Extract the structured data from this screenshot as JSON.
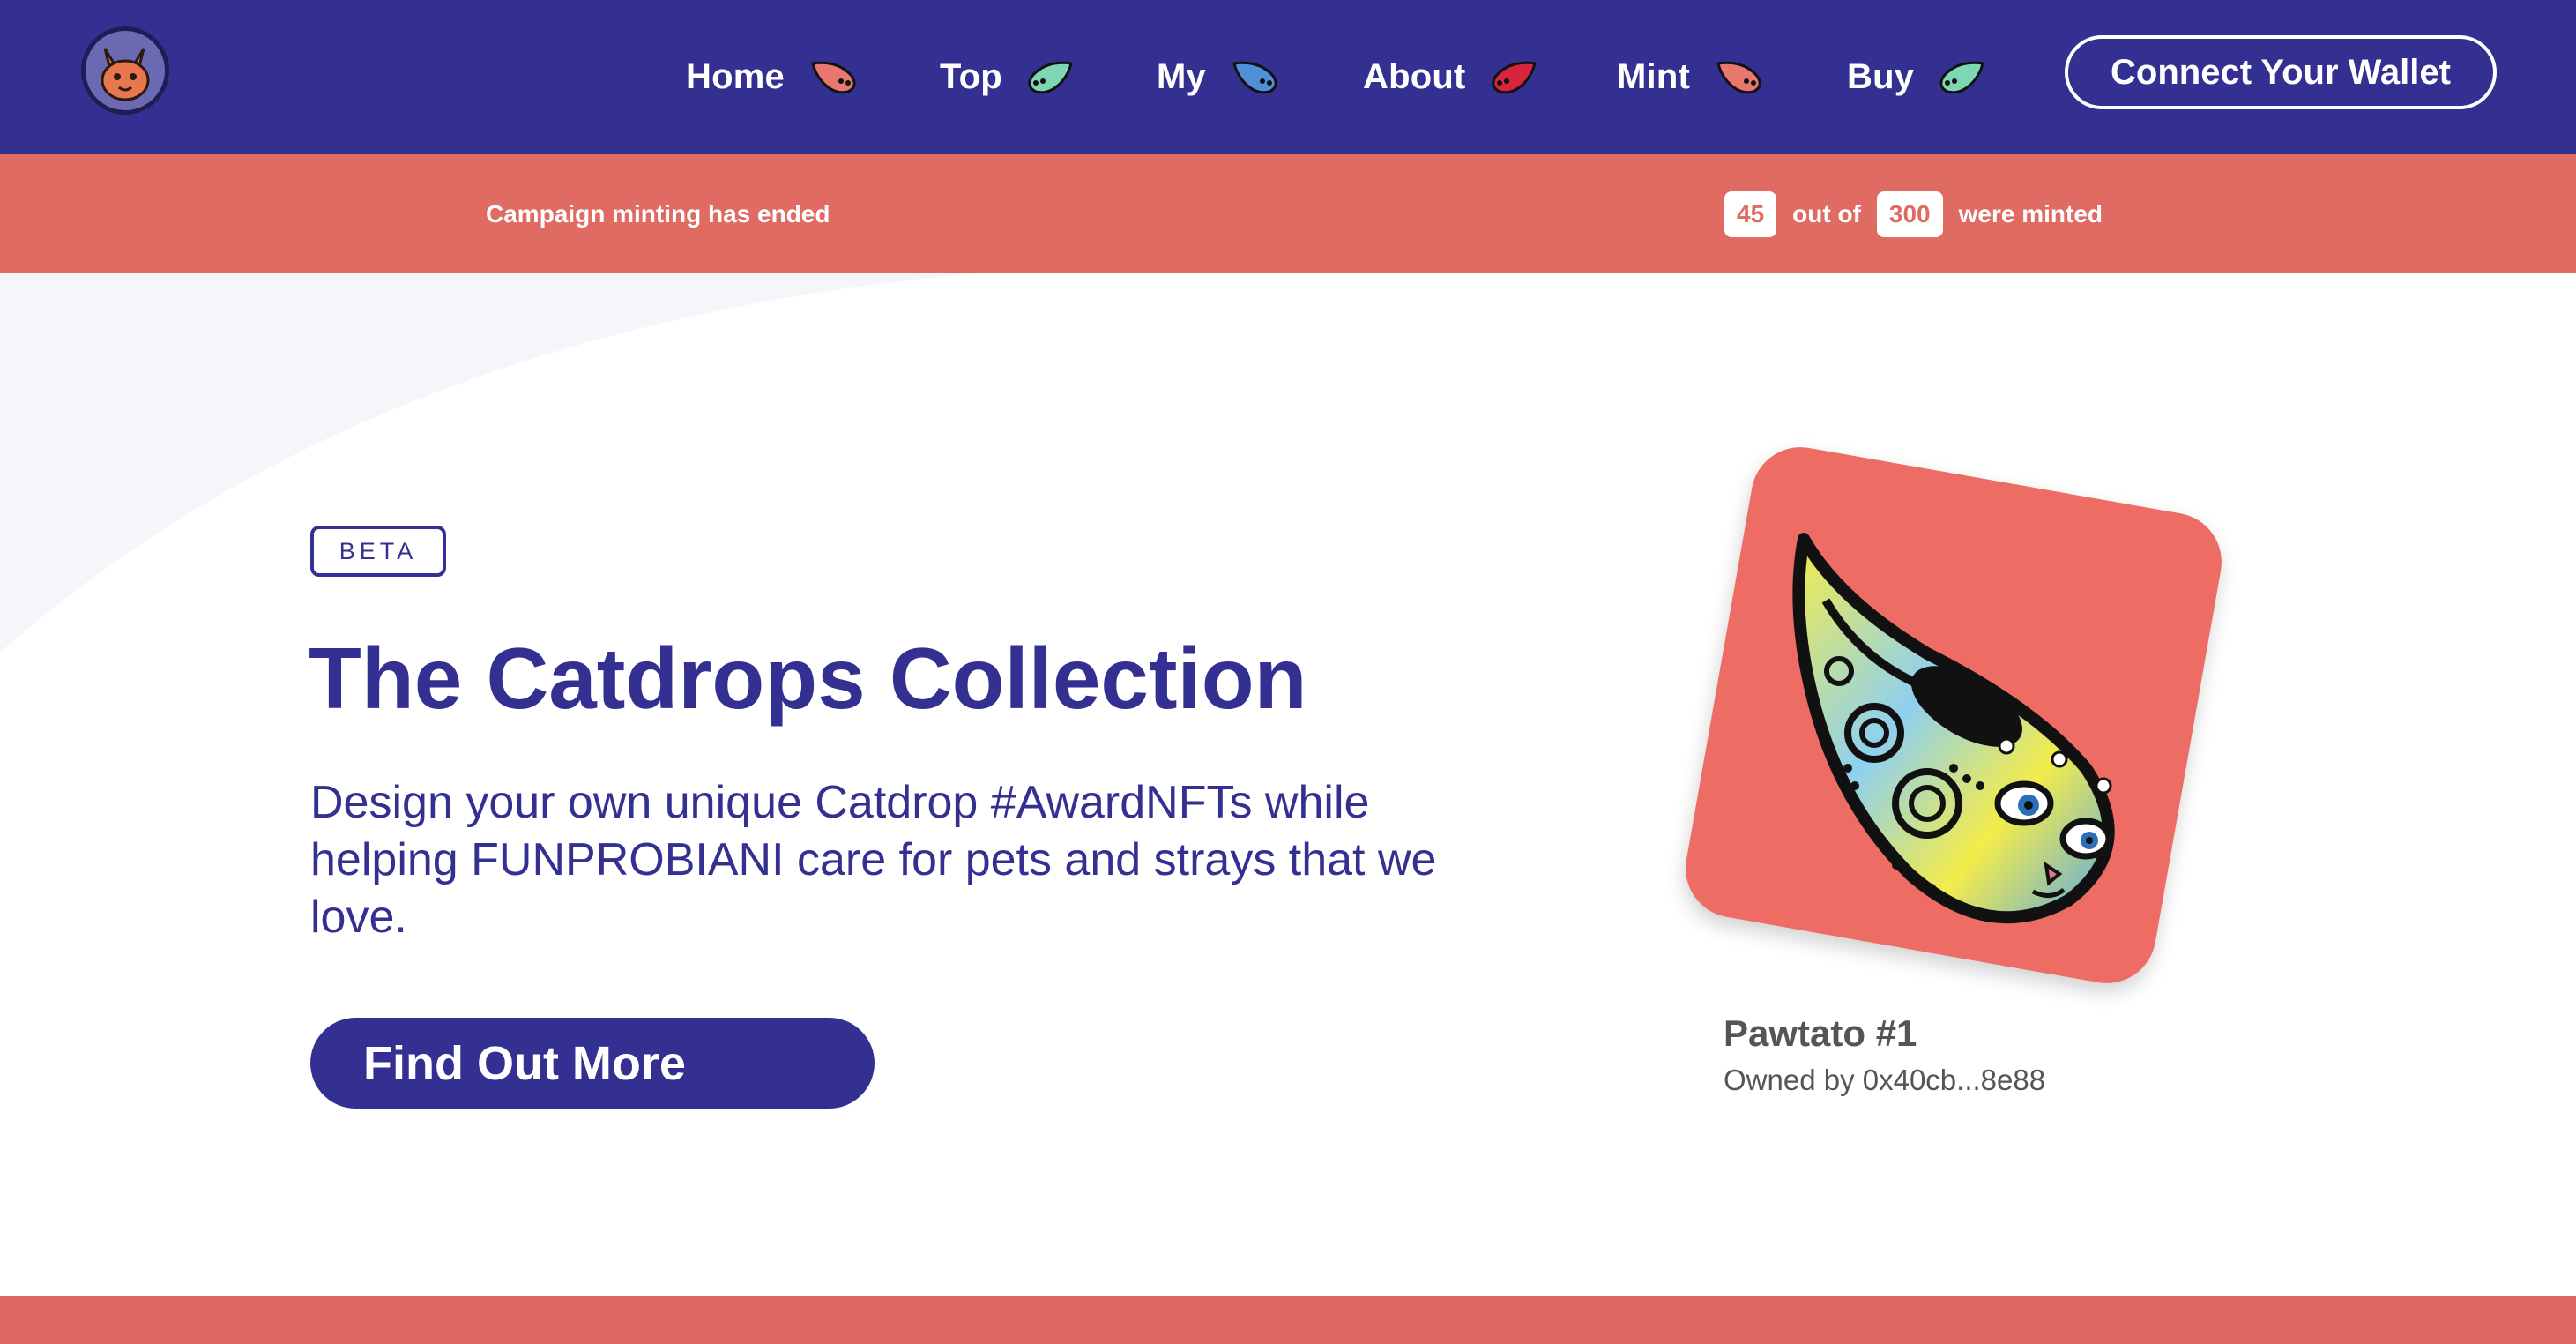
{
  "header": {
    "logo_alt": "Catdrops logo",
    "nav": [
      {
        "label": "Home",
        "drop_color": "#e8776f"
      },
      {
        "label": "Top",
        "drop_color": "#7ed7b4"
      },
      {
        "label": "My",
        "drop_color": "#4f8fd8"
      },
      {
        "label": "About",
        "drop_color": "#d8243f"
      },
      {
        "label": "Mint",
        "drop_color": "#e8776f"
      },
      {
        "label": "Buy",
        "drop_color": "#7ed7b4"
      }
    ],
    "connect_label": "Connect Your Wallet"
  },
  "status": {
    "campaign_text": "Campaign minting has ended",
    "minted": "45",
    "out_of_label": "out of",
    "total": "300",
    "minted_label": "were minted"
  },
  "hero": {
    "badge": "BETA",
    "title": "The Catdrops Collection",
    "description": "Design your own unique Catdrop #AwardNFTs while helping FUNPROBIANI care for pets and strays that we love.",
    "cta_label": "Find Out More"
  },
  "featured_nft": {
    "name": "Pawtato #1",
    "owner": "Owned by 0x40cb...8e88"
  },
  "colors": {
    "brand_navy": "#333092",
    "accent_coral": "#e06b63",
    "card_coral": "#ed6c64",
    "text_gray": "#555555"
  }
}
